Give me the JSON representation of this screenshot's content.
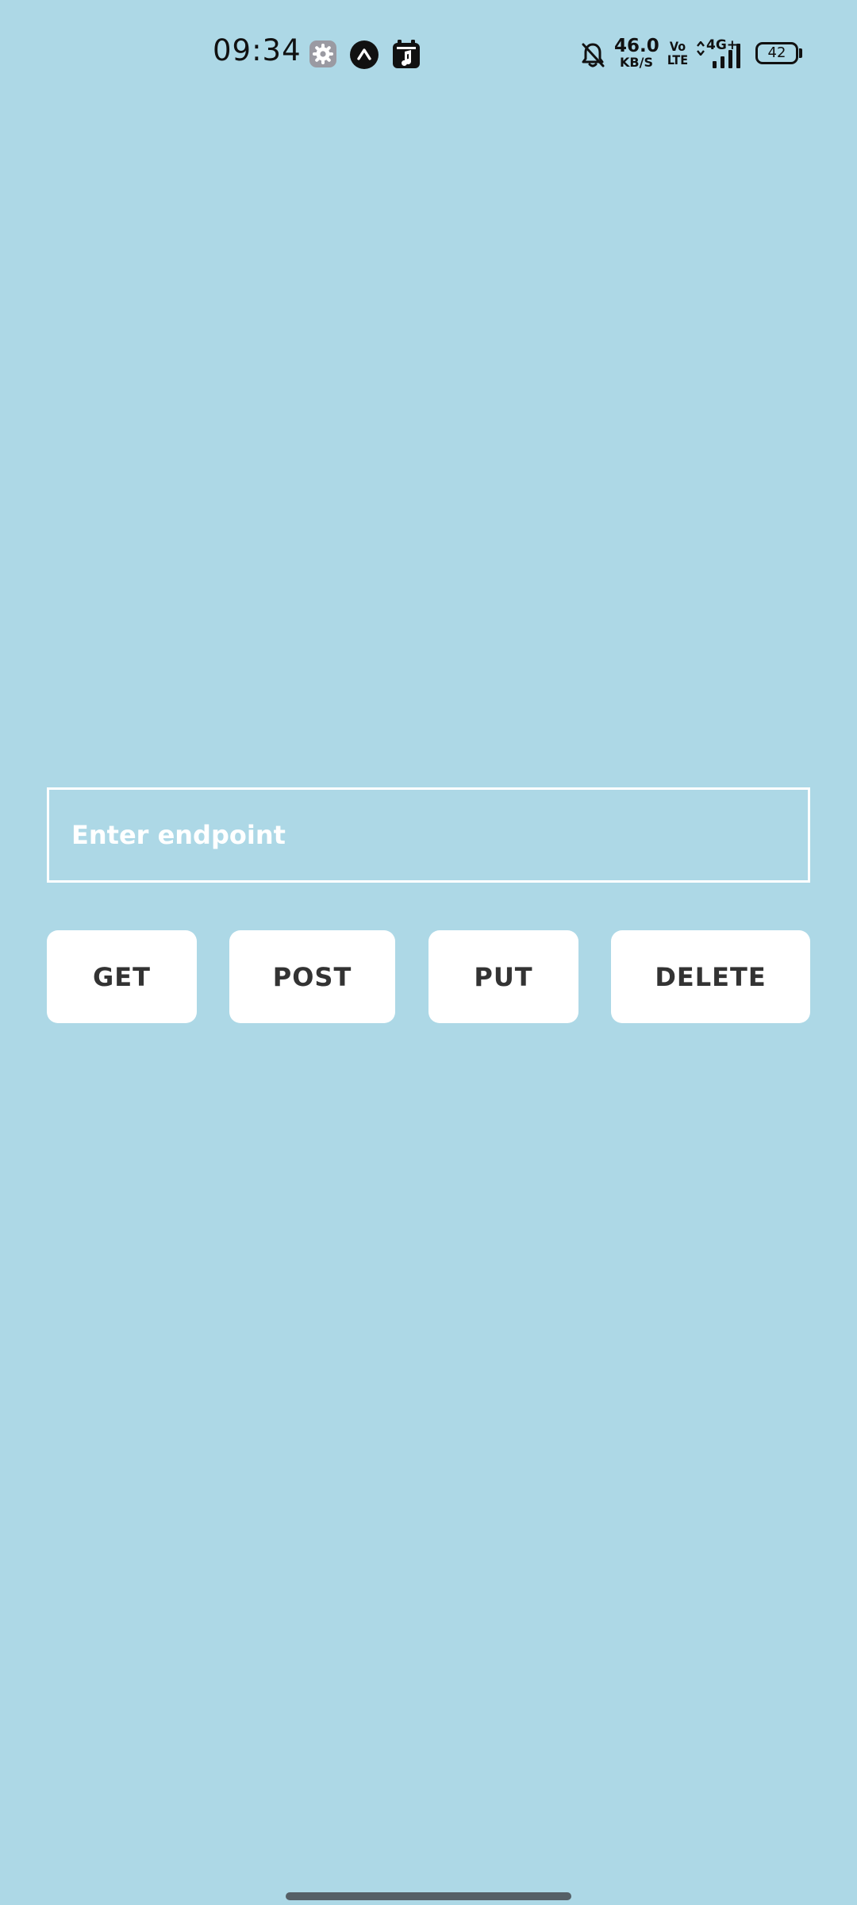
{
  "status_bar": {
    "time": "09:34",
    "net_speed_value": "46.0",
    "net_speed_unit": "KB/S",
    "volte_top": "Vo",
    "volte_bottom": "LTE",
    "network_type": "4G+",
    "battery_level": "42",
    "notification_icons": [
      "settings-gear-icon",
      "app-caret-icon",
      "media-app-icon"
    ],
    "system_icons": [
      "bell-muted-icon",
      "signal-bars-icon",
      "battery-icon"
    ]
  },
  "form": {
    "endpoint_placeholder": "Enter endpoint",
    "endpoint_value": ""
  },
  "actions": {
    "get_label": "GET",
    "post_label": "POST",
    "put_label": "PUT",
    "delete_label": "DELETE"
  },
  "colors": {
    "background": "#add8e6",
    "button_background": "#ffffff",
    "button_text": "#333333",
    "input_border": "#ffffff",
    "placeholder_text": "#ffffff",
    "status_text": "#111111",
    "home_indicator": "#555f66"
  }
}
